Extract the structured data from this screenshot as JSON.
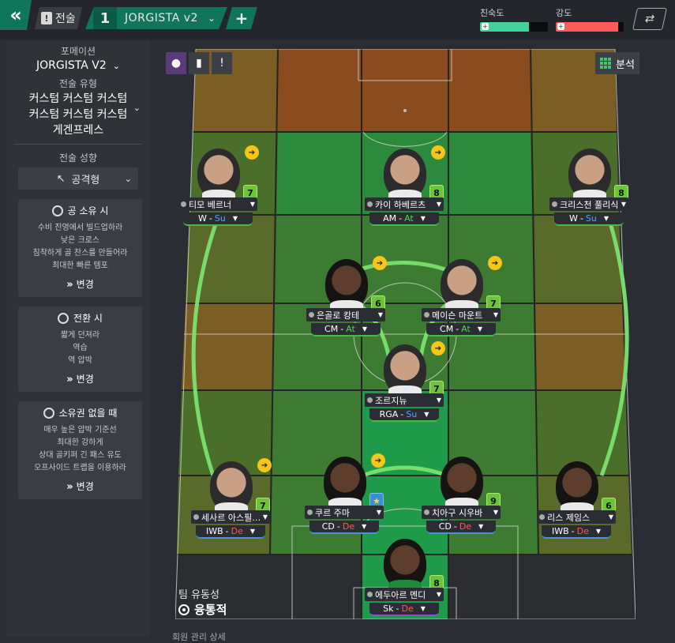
{
  "topbar": {
    "tactic_tab_label": "전술",
    "tactic_number": "1",
    "tactic_name": "JORGISTA v2",
    "add_label": "+",
    "familiarity_label": "친숙도",
    "familiarity_fraction": 0.72,
    "familiarity_color": "#41d49a",
    "intensity_label": "강도",
    "intensity_fraction": 0.92,
    "intensity_color": "#ff5a5a"
  },
  "left": {
    "formation_label": "포메이션",
    "formation_value": "JORGISTA V2",
    "style_label": "전술 유형",
    "style_line1": "커스텀 커스텀 커스텀",
    "style_line2": "커스텀 커스텀 커스텀",
    "style_line3": "게겐프레스",
    "mentality_label": "전술 성향",
    "mentality_value": "공격형",
    "possession": {
      "title": "공 소유 시",
      "lines": [
        "수비 진영에서 빌드업하라",
        "낮은 크로스",
        "침착하게 골 찬스를 만들어라",
        "최대한 빠른 템포"
      ],
      "button": "변경"
    },
    "transition": {
      "title": "전환 시",
      "lines": [
        "짧게 던져라",
        "역습",
        "역 압박"
      ],
      "button": "변경"
    },
    "out_of_possession": {
      "title": "소유권 없을 때",
      "lines": [
        "매우 높은 압박 기준선",
        "최대한 강하게",
        "상대 골키퍼 긴 패스 유도",
        "오프사이드 트랩을 이용하라"
      ],
      "button": "변경"
    }
  },
  "pitch": {
    "analysis_label": "분석",
    "fluidity_label": "팀 유동성",
    "fluidity_value": "융통적",
    "footer_text": "회원 관리 상세"
  },
  "players": [
    {
      "name": "티모 베르너",
      "role": "W",
      "duty": "Su",
      "rating": "7"
    },
    {
      "name": "카이 하베르츠",
      "role": "AM",
      "duty": "At",
      "rating": "8"
    },
    {
      "name": "크리스천 풀리식",
      "role": "W",
      "duty": "Su",
      "rating": "8"
    },
    {
      "name": "은골로 캉테",
      "role": "CM",
      "duty": "At",
      "rating": "6"
    },
    {
      "name": "메이슨 마운트",
      "role": "CM",
      "duty": "At",
      "rating": "7"
    },
    {
      "name": "조르지뉴",
      "role": "RGA",
      "duty": "Su",
      "rating": "7"
    },
    {
      "name": "세사르 아스필리쿠...",
      "role": "IWB",
      "duty": "De",
      "rating": "7"
    },
    {
      "name": "쿠르 주마",
      "role": "CD",
      "duty": "De",
      "rating": "★"
    },
    {
      "name": "치아구 시우바",
      "role": "CD",
      "duty": "De",
      "rating": "9"
    },
    {
      "name": "리스 제임스",
      "role": "IWB",
      "duty": "De",
      "rating": "6"
    },
    {
      "name": "에두아르 멘디",
      "role": "Sk",
      "duty": "De",
      "rating": "8"
    }
  ]
}
